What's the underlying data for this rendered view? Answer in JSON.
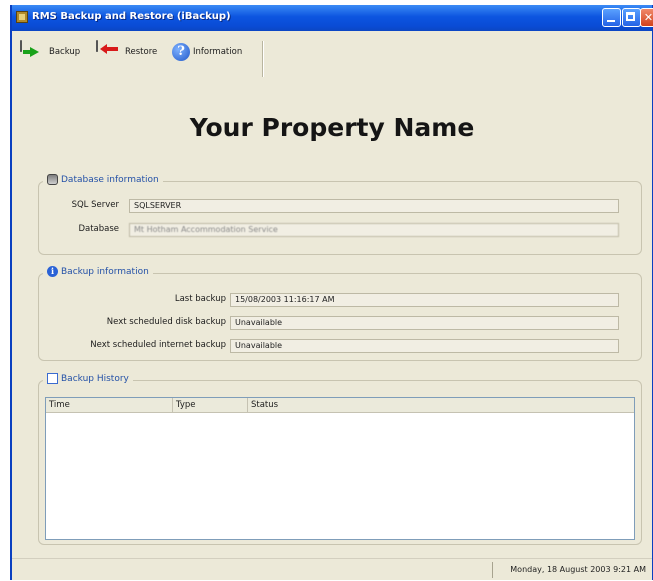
{
  "window": {
    "title": "RMS Backup and Restore (iBackup)"
  },
  "toolbar": {
    "backup_label": "Backup",
    "restore_label": "Restore",
    "information_label": "Information"
  },
  "property_name": "Your Property Name",
  "database_info": {
    "title": "Database information",
    "sql_server_label": "SQL Server",
    "sql_server_value": "SQLSERVER",
    "database_label": "Database",
    "database_value": "Mt Hotham Accommodation Service"
  },
  "backup_info": {
    "title": "Backup information",
    "last_backup_label": "Last backup",
    "last_backup_value": "15/08/2003 11:16:17 AM",
    "next_disk_label": "Next scheduled disk backup",
    "next_disk_value": "Unavailable",
    "next_internet_label": "Next scheduled internet backup",
    "next_internet_value": "Unavailable"
  },
  "backup_history": {
    "title": "Backup History",
    "columns": [
      "Time",
      "Type",
      "Status"
    ],
    "rows": []
  },
  "statusbar": {
    "datetime": "Monday, 18 August 2003 9:21 AM"
  }
}
